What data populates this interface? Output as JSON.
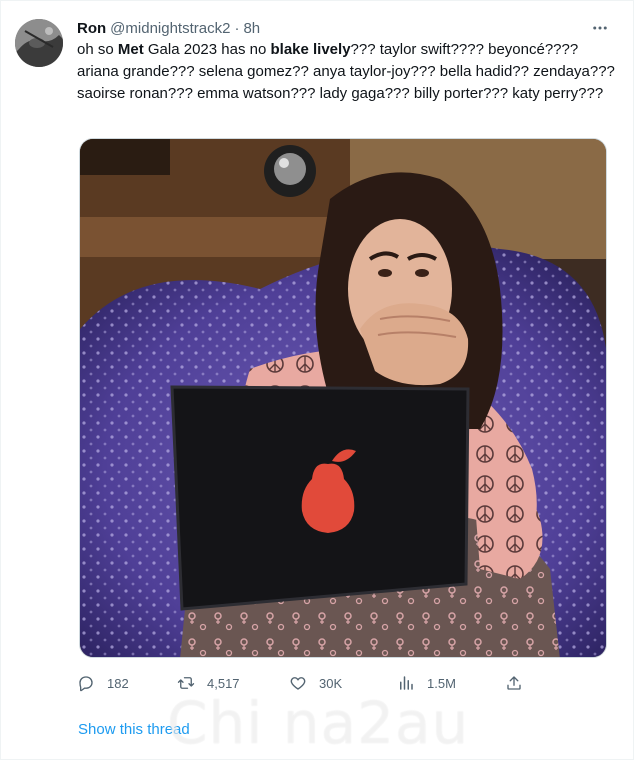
{
  "author": {
    "name": "Ron",
    "handle": "@midnightstrack2",
    "separator": "·",
    "time": "8h",
    "avatar_icon": "avatar-photo"
  },
  "more_icon": "more-icon",
  "tweet": {
    "t1": "oh so ",
    "b1": "Met",
    "t2": " Gala 2023 has no ",
    "b2": "blake lively",
    "t3": "??? taylor swift???? beyoncé???? ariana grande??? selena gomez?? anya taylor-joy??? bella hadid?? zendaya??? saoirse ronan??? emma watson??? lady gaga??? billy porter??? katy perry???"
  },
  "media": {
    "description_icon": "meme-photo"
  },
  "actions": {
    "reply_count": "182",
    "retweet_count": "4,517",
    "like_count": "30K",
    "views_count": "1.5M",
    "icons": [
      "reply-icon",
      "retweet-icon",
      "like-icon",
      "views-icon",
      "share-icon"
    ]
  },
  "show_thread": "Show this thread",
  "watermark": "Chi na2au",
  "colors": {
    "link": "#1d9bf0",
    "secondary_text": "#536471"
  }
}
